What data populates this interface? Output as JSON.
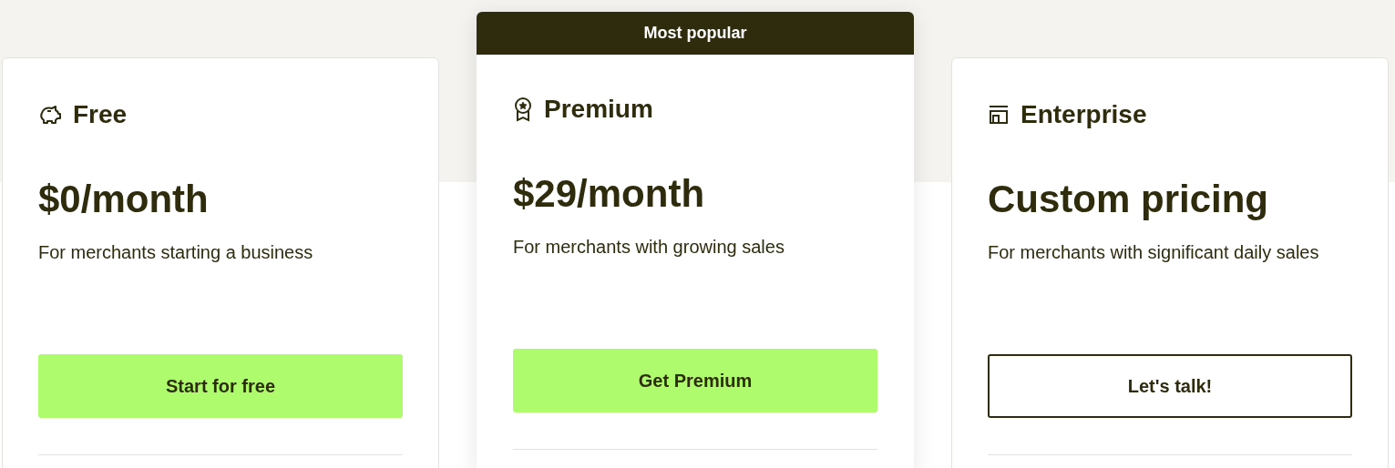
{
  "plans": [
    {
      "kind": "free",
      "name": "Free",
      "price": "$0/month",
      "description": "For merchants starting a business",
      "button": {
        "label": "Start for free",
        "kind": "primary"
      }
    },
    {
      "kind": "premium",
      "name": "Premium",
      "price": "$29/month",
      "description": "For merchants with growing sales",
      "button": {
        "label": "Get Premium",
        "kind": "primary"
      },
      "badge": "Most popular"
    },
    {
      "kind": "enterprise",
      "name": "Enterprise",
      "price": "Custom pricing",
      "description": "For merchants with significant daily sales",
      "button": {
        "label": "Let's talk!",
        "kind": "outline"
      }
    }
  ]
}
